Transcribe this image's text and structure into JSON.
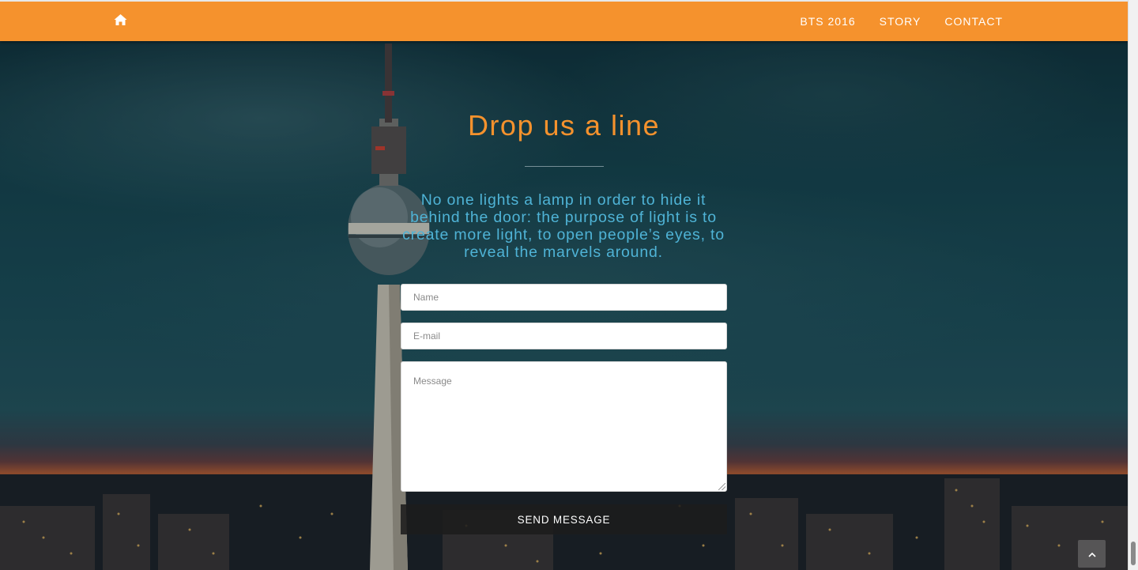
{
  "nav": {
    "home_icon": "home-icon",
    "links": [
      "BTS 2016",
      "STORY",
      "CONTACT"
    ]
  },
  "contact": {
    "heading": "Drop us a line",
    "lead": "No one lights a lamp in order to hide it behind the door: the purpose of light is to create more light, to open people’s eyes, to reveal the marvels around.",
    "name_placeholder": "Name",
    "email_placeholder": "E-mail",
    "message_placeholder": "Message",
    "send_label": "SEND MESSAGE"
  },
  "back_to_top_icon": "chevron-up-icon",
  "colors": {
    "accent": "#f5922d",
    "lead_text": "#4fb3d6",
    "button_bg": "#1c1c1c"
  }
}
